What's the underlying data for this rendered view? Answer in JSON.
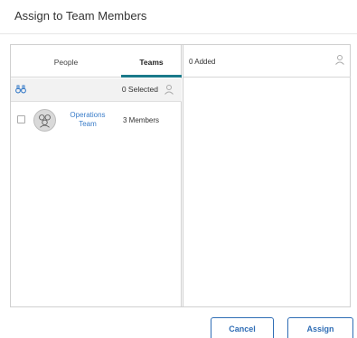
{
  "dialog": {
    "title": "Assign to Team Members"
  },
  "left_panel": {
    "tabs": [
      {
        "label": "People",
        "active": false
      },
      {
        "label": "Teams",
        "active": true
      }
    ],
    "selected_label": "0 Selected",
    "teams": [
      {
        "name_line1": "Operations",
        "name_line2": "Team",
        "members": "3 Members",
        "checked": false
      }
    ]
  },
  "right_panel": {
    "added_label": "0 Added"
  },
  "buttons": {
    "cancel": "Cancel",
    "assign": "Assign"
  },
  "colors": {
    "accent_tab": "#1a7a8a",
    "link": "#3a7dc9",
    "button": "#2f6db5"
  },
  "icons": {
    "search": "binoculars-icon",
    "person": "person-icon",
    "team": "team-avatar-icon"
  }
}
